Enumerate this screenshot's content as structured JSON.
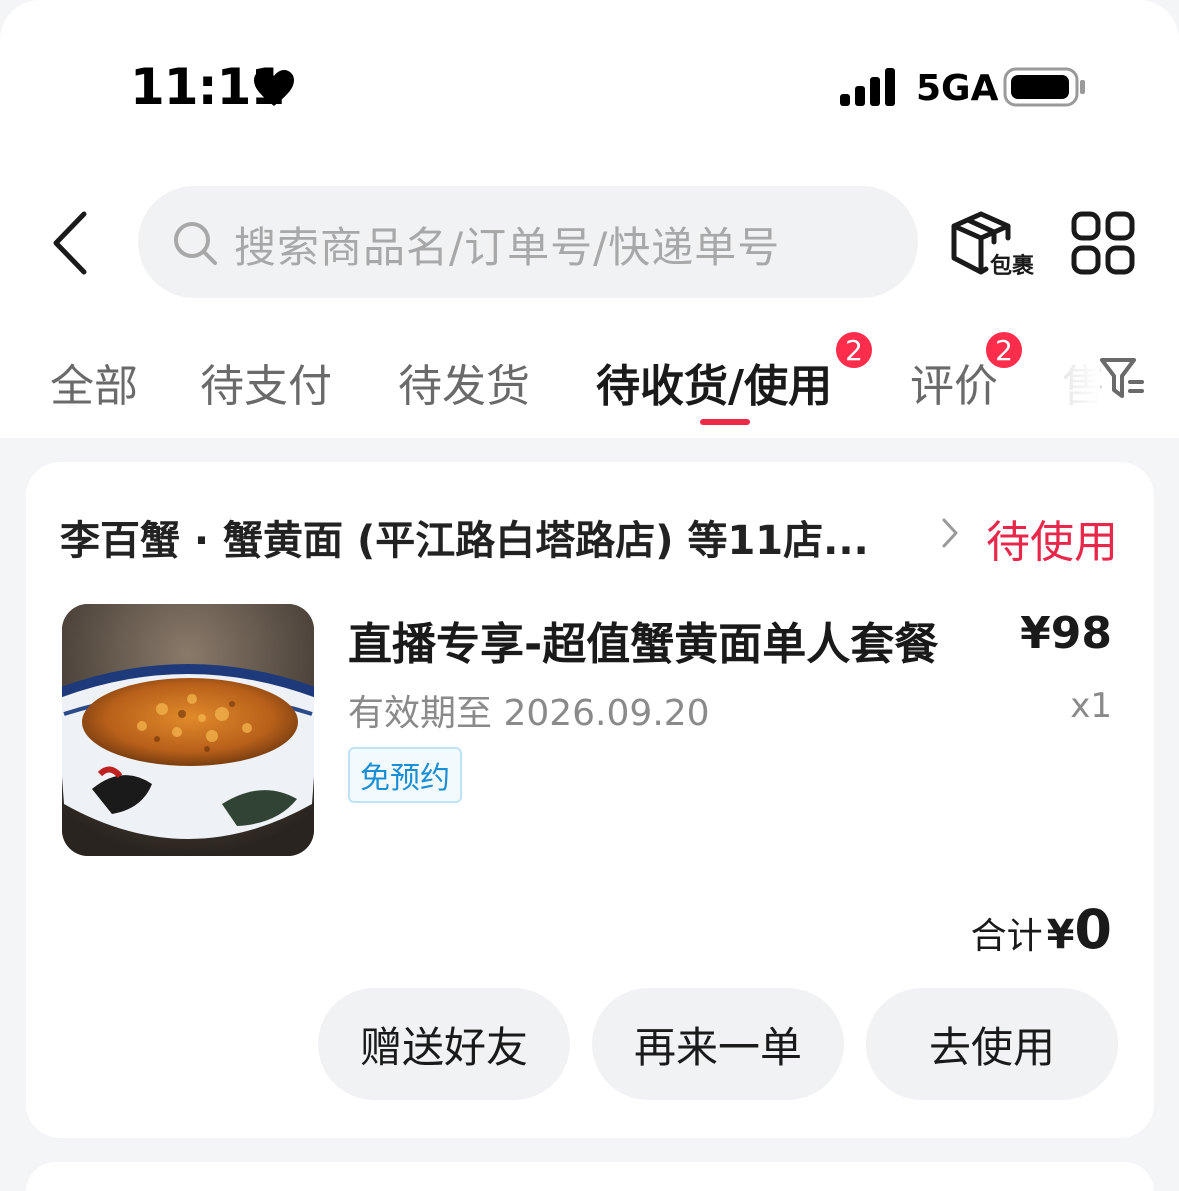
{
  "status_bar": {
    "time": "11:11",
    "network": "5GA"
  },
  "header": {
    "search_placeholder": "搜索商品名/订单号/快递单号",
    "package_label": "包裹"
  },
  "tabs": [
    {
      "label": "全部",
      "active": false
    },
    {
      "label": "待支付",
      "active": false
    },
    {
      "label": "待发货",
      "active": false
    },
    {
      "label": "待收货/使用",
      "active": true,
      "badge": "2"
    },
    {
      "label": "评价",
      "active": false,
      "badge": "2"
    },
    {
      "label": "售",
      "active": false
    }
  ],
  "order": {
    "store_name": "李百蟹 · 蟹黄面 (平江路白塔路店) 等11店...",
    "status": "待使用",
    "product_title": "直播专享-超值蟹黄面单人套餐",
    "price": "¥98",
    "validity": "有效期至 2026.09.20",
    "quantity": "x1",
    "tag": "免预约",
    "total_label": "合计",
    "total_currency": "¥",
    "total_amount": "0",
    "actions": [
      "赠送好友",
      "再来一单",
      "去使用"
    ]
  },
  "colors": {
    "accent_red": "#ee2b47",
    "badge_red": "#ff2d4c",
    "tag_blue": "#1a8fd6",
    "page_background": "#f4f5f7"
  }
}
